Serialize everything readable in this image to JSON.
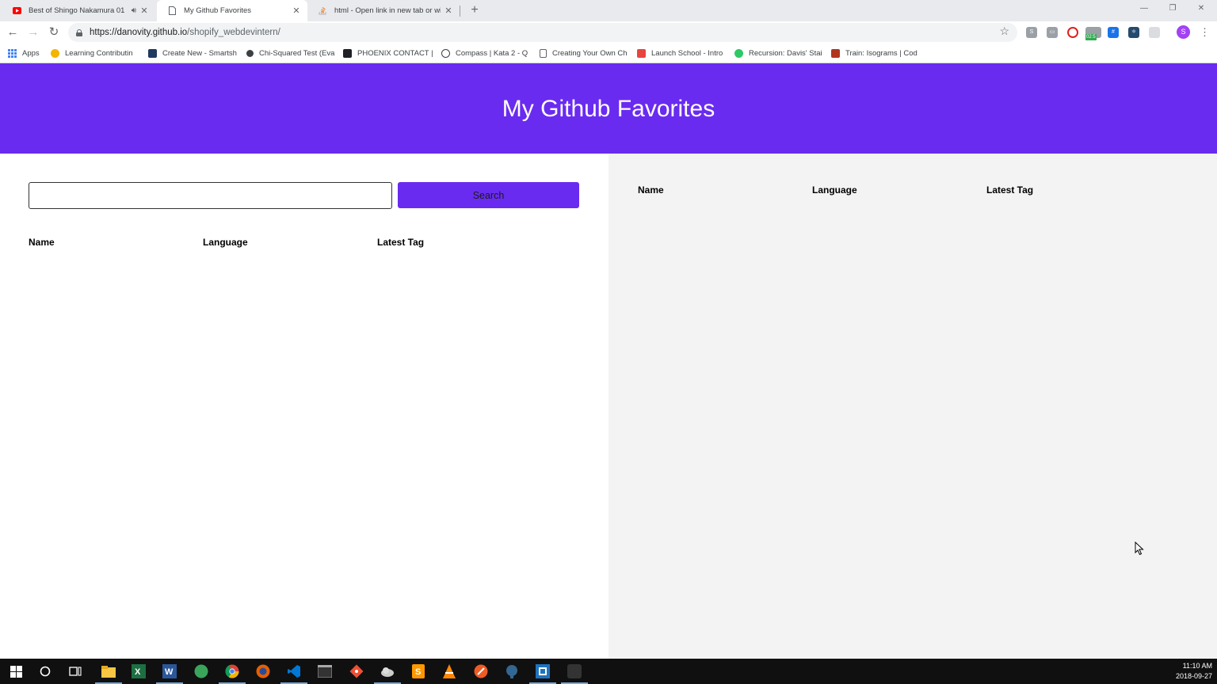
{
  "browser": {
    "tabs": [
      {
        "title": "Best of Shingo Nakamura 01",
        "icon": "youtube-icon",
        "has_audio": true
      },
      {
        "title": "My Github Favorites",
        "icon": "page-icon",
        "active": true
      },
      {
        "title": "html - Open link in new tab or wi",
        "icon": "stackoverflow-icon"
      }
    ],
    "url_host": "https://danovity.github.io",
    "url_path": "/shopify_webdevintern/",
    "profile_initial": "S",
    "extension_badge": "02:5"
  },
  "bookmarks": [
    {
      "label": "Apps",
      "icon": "apps-grid-icon"
    },
    {
      "label": "Learning Contributin",
      "icon": "star-badge-icon"
    },
    {
      "label": "Create New - Smartsh",
      "icon": "smartsheet-icon"
    },
    {
      "label": "Chi-Squared Test (Eva",
      "icon": "bookmark-icon"
    },
    {
      "label": "PHOENIX CONTACT |",
      "icon": "phoenix-contact-icon"
    },
    {
      "label": "Compass | Kata 2 - Q",
      "icon": "compass-icon"
    },
    {
      "label": "Creating Your Own Ch",
      "icon": "page-icon"
    },
    {
      "label": "Launch School - Intro",
      "icon": "launch-school-icon"
    },
    {
      "label": "Recursion: Davis' Stai",
      "icon": "hackerrank-icon"
    },
    {
      "label": "Train: Isograms | Cod",
      "icon": "codewars-icon"
    }
  ],
  "app": {
    "title": "My Github Favorites",
    "search": {
      "value": "",
      "button_label": "Search"
    },
    "results_columns": [
      "Name",
      "Language",
      "Latest Tag"
    ],
    "favorites_columns": [
      "Name",
      "Language",
      "Latest Tag"
    ],
    "accent_color": "#6a2bf0"
  },
  "taskbar": {
    "apps": [
      "start-icon",
      "cortana-icon",
      "task-view-icon",
      "file-explorer-icon",
      "excel-icon",
      "word-icon",
      "green-app-icon",
      "chrome-icon",
      "firefox-icon",
      "vscode-icon",
      "terminal-icon",
      "git-icon",
      "cloud-app-icon",
      "sublime-icon",
      "vlc-icon",
      "postman-icon",
      "postgres-icon",
      "dark-app-icon",
      "faded-app-icon"
    ],
    "time": "11:10 AM",
    "date": "2018-09-27"
  }
}
